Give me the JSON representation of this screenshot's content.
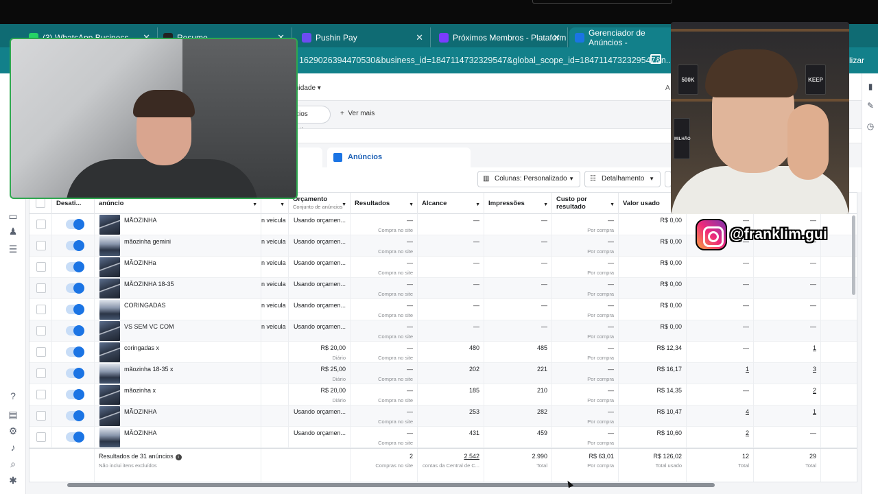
{
  "browser": {
    "tabs": [
      {
        "title": "(3) WhatsApp Business",
        "color": "#25d366"
      },
      {
        "title": "Resumo",
        "color": "#222222"
      },
      {
        "title": "Pushin Pay",
        "color": "#6c4cf1"
      },
      {
        "title": "Próximos Membros - Plataform",
        "color": "#7a3cff"
      },
      {
        "title": "Gerenciador de Anúncios -",
        "color": "#1b74e4"
      }
    ],
    "url": "1629026394470530&business_id=1847114732329547&global_scope_id=1847114732329547&n...",
    "update_label": "lizar"
  },
  "toolbar": {
    "unidade_label": "nidade",
    "right_label": "A",
    "chip_label": "cios ativos",
    "ver_mais": "Ver mais"
  },
  "tabs": {
    "anuncios": "Anúncios"
  },
  "controls": {
    "colunas": "Colunas: Personalizado",
    "detalhamento": "Detalhamento"
  },
  "table": {
    "headers": {
      "desativ": "Desati...",
      "anuncio": "anúncio",
      "orcamento": "Orçamento",
      "orcamento_sub": "Conjunto de anúncios",
      "resultados": "Resultados",
      "alcance": "Alcance",
      "impressoes": "Impressões",
      "custo": "Custo por resultado",
      "valor": "Valor usado"
    },
    "rows": [
      {
        "name": "MÃOZINHA",
        "veicula": "n veicula",
        "orc": "Usando orçamen...",
        "orc_sub": "",
        "res": "—",
        "res_sub": "Compra no site",
        "alc": "—",
        "imp": "—",
        "custo": "—",
        "custo_sub": "Por compra",
        "valor": "R$ 0,00",
        "c1": "—",
        "c2": "—"
      },
      {
        "name": "mãozinha gemini",
        "veicula": "n veicula",
        "orc": "Usando orçamen...",
        "orc_sub": "",
        "res": "—",
        "res_sub": "Compra no site",
        "alc": "—",
        "imp": "—",
        "custo": "—",
        "custo_sub": "Por compra",
        "valor": "R$ 0,00",
        "c1": "—",
        "c2": "—"
      },
      {
        "name": "MÃOZINHa",
        "veicula": "n veicula",
        "orc": "Usando orçamen...",
        "orc_sub": "",
        "res": "—",
        "res_sub": "Compra no site",
        "alc": "—",
        "imp": "—",
        "custo": "—",
        "custo_sub": "Por compra",
        "valor": "R$ 0,00",
        "c1": "—",
        "c2": "—"
      },
      {
        "name": "MÃOZINHA 18-35",
        "veicula": "n veicula",
        "orc": "Usando orçamen...",
        "orc_sub": "",
        "res": "—",
        "res_sub": "Compra no site",
        "alc": "—",
        "imp": "—",
        "custo": "—",
        "custo_sub": "Por compra",
        "valor": "R$ 0,00",
        "c1": "—",
        "c2": "—"
      },
      {
        "name": "CORINGADAS",
        "veicula": "n veicula",
        "orc": "Usando orçamen...",
        "orc_sub": "",
        "res": "—",
        "res_sub": "Compra no site",
        "alc": "—",
        "imp": "—",
        "custo": "—",
        "custo_sub": "Por compra",
        "valor": "R$ 0,00",
        "c1": "—",
        "c2": "—"
      },
      {
        "name": "VS SEM VC COM",
        "veicula": "n veicula",
        "orc": "Usando orçamen...",
        "orc_sub": "",
        "res": "—",
        "res_sub": "Compra no site",
        "alc": "—",
        "imp": "—",
        "custo": "—",
        "custo_sub": "Por compra",
        "valor": "R$ 0,00",
        "c1": "—",
        "c2": "—"
      },
      {
        "name": "coringadas x",
        "veicula": "",
        "orc": "R$ 20,00",
        "orc_sub": "Diário",
        "res": "—",
        "res_sub": "Compra no site",
        "alc": "480",
        "imp": "485",
        "custo": "—",
        "custo_sub": "Por compra",
        "valor": "R$ 12,34",
        "c1": "—",
        "c2": "1"
      },
      {
        "name": "mãozinha 18-35 x",
        "veicula": "",
        "orc": "R$ 25,00",
        "orc_sub": "Diário",
        "res": "—",
        "res_sub": "Compra no site",
        "alc": "202",
        "imp": "221",
        "custo": "—",
        "custo_sub": "Por compra",
        "valor": "R$ 16,17",
        "c1": "1",
        "c2": "3"
      },
      {
        "name": "mãozinha x",
        "veicula": "",
        "orc": "R$ 20,00",
        "orc_sub": "Diário",
        "res": "—",
        "res_sub": "Compra no site",
        "alc": "185",
        "imp": "210",
        "custo": "—",
        "custo_sub": "Por compra",
        "valor": "R$ 14,35",
        "c1": "—",
        "c2": "2"
      },
      {
        "name": "MÃOZINHA",
        "veicula": "",
        "orc": "Usando orçamen...",
        "orc_sub": "",
        "res": "—",
        "res_sub": "Compra no site",
        "alc": "253",
        "imp": "282",
        "custo": "—",
        "custo_sub": "Por compra",
        "valor": "R$ 10,47",
        "c1": "4",
        "c2": "1"
      },
      {
        "name": "MÃOZINHA",
        "veicula": "",
        "orc": "Usando orçamen...",
        "orc_sub": "",
        "res": "—",
        "res_sub": "Compra no site",
        "alc": "431",
        "imp": "459",
        "custo": "—",
        "custo_sub": "Por compra",
        "valor": "R$ 10,60",
        "c1": "2",
        "c2": "—"
      }
    ],
    "footer": {
      "label": "Resultados de 31 anúncios",
      "label_sub": "Não inclui itens excluídos",
      "res": "2",
      "res_sub": "Compras no site",
      "alc": "2.542",
      "alc_sub": "contas da Central de C...",
      "imp": "2.990",
      "imp_sub": "Total",
      "custo": "R$ 63,01",
      "custo_sub": "Por compra",
      "valor": "R$ 126,02",
      "valor_sub": "Total usado",
      "c1": "12",
      "c1_sub": "Total",
      "c2": "29",
      "c2_sub": "Total"
    }
  },
  "overlay": {
    "instagram_handle": "@franklim.gui",
    "book_labels": [
      "500K",
      "KEEP",
      "MILHÃO"
    ]
  }
}
